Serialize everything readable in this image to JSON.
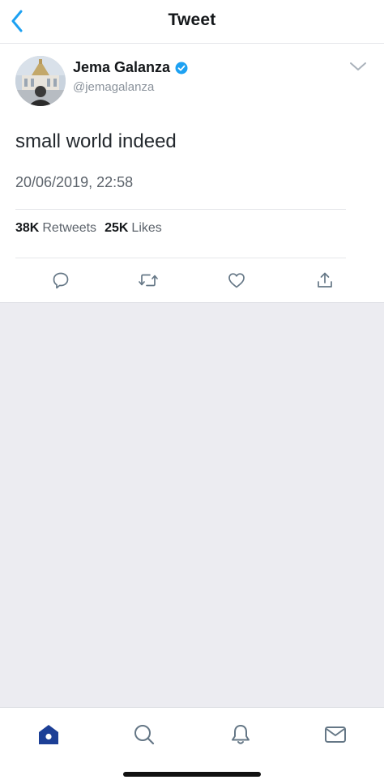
{
  "nav": {
    "title": "Tweet",
    "back_icon": "chevron-left-icon"
  },
  "tweet": {
    "author_name": "Jema Galanza",
    "handle": "@jemagalanza",
    "verified": true,
    "text": "small world indeed",
    "timestamp": "20/06/2019, 22:58",
    "stats": {
      "retweets_count": "38K",
      "retweets_label": "Retweets",
      "likes_count": "25K",
      "likes_label": "Likes"
    },
    "actions": [
      "reply-icon",
      "retweet-icon",
      "like-icon",
      "share-icon"
    ]
  },
  "tab_bar": {
    "items": [
      "home-icon",
      "search-icon",
      "notifications-icon",
      "messages-icon"
    ],
    "active": "home"
  },
  "colors": {
    "accent": "#1da1f2",
    "active_tab": "#1c3f96",
    "icon_gray": "#657786",
    "background_empty": "#ececf1"
  }
}
